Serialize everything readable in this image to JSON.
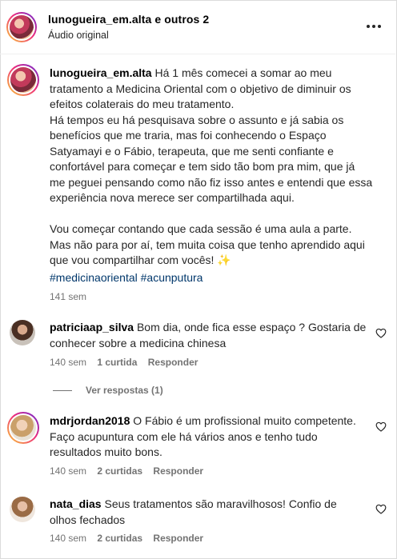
{
  "header": {
    "username": "lunogueira_em.alta e outros 2",
    "audio_label": "Áudio original",
    "more_icon": "more-horizontal-icon"
  },
  "post": {
    "username": "lunogueira_em.alta",
    "text": "Há 1 mês comecei a somar ao meu tratamento a Medicina Oriental com o objetivo de diminuir os efeitos colaterais do meu tratamento.\nHá tempos eu há pesquisava sobre o assunto e já sabia os benefícios que me traria, mas foi conhecendo o Espaço Satyamayi e o Fábio, terapeuta, que me senti confiante e confortável para começar e tem sido tão bom pra mim, que já me peguei pensando como não fiz isso antes e entendi que essa experiência nova merece ser compartilhada aqui.\n\nVou começar contando que cada sessão é uma aula a parte. Mas não para por aí, tem muita coisa que tenho aprendido aqui que vou compartilhar com vocês!",
    "sparkle": "✨",
    "hashtag_1": "#medicinaoriental",
    "hashtag_2": "#acunputura",
    "time": "141 sem"
  },
  "comments": [
    {
      "username": "patriciaap_silva",
      "text": "Bom dia, onde fica esse espaço ? Gostaria de conhecer sobre a medicina chinesa",
      "time": "140 sem",
      "likes": "1 curtida",
      "reply": "Responder",
      "view_replies": "Ver respostas (1)"
    },
    {
      "username": "mdrjordan2018",
      "text": "O Fábio é um profissional muito competente. Faço acupuntura com ele há vários anos e tenho tudo resultados muito bons.",
      "time": "140 sem",
      "likes": "2 curtidas",
      "reply": "Responder"
    },
    {
      "username": "nata_dias",
      "text": "Seus tratamentos são maravilhosos! Confio de olhos fechados",
      "time": "140 sem",
      "likes": "2 curtidas",
      "reply": "Responder"
    }
  ],
  "icons": {
    "like": "heart-icon"
  },
  "colors": {
    "hashtag": "#00376b",
    "meta": "#737373",
    "story_ring": "#ee2a7b"
  }
}
